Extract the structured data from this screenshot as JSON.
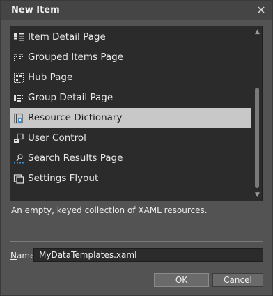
{
  "dialog": {
    "title": "New Item",
    "close_label": "✕"
  },
  "templates": {
    "items": [
      {
        "label": "Item Detail Page",
        "icon": "item-detail-page-icon"
      },
      {
        "label": "Grouped Items Page",
        "icon": "grouped-items-page-icon"
      },
      {
        "label": "Hub Page",
        "icon": "hub-page-icon"
      },
      {
        "label": "Group Detail Page",
        "icon": "group-detail-page-icon"
      },
      {
        "label": "Resource Dictionary",
        "icon": "resource-dictionary-icon",
        "selected": true
      },
      {
        "label": "User Control",
        "icon": "user-control-icon"
      },
      {
        "label": "Search Results Page",
        "icon": "search-results-page-icon"
      },
      {
        "label": "Settings Flyout",
        "icon": "settings-flyout-icon"
      }
    ],
    "scroll_up": "▲",
    "scroll_down": "▼"
  },
  "description": "An empty, keyed collection of XAML resources.",
  "name_field": {
    "label_mnemonic": "N",
    "label_rest": "ame",
    "value": "MyDataTemplates.xaml"
  },
  "buttons": {
    "ok_label": "OK",
    "cancel_label": "Cancel"
  },
  "colors": {
    "dialog_bg": "#535353",
    "list_bg": "#2b2b2b",
    "selection_bg": "#c8c8c8",
    "icon_blue": "#3b8fd8"
  }
}
